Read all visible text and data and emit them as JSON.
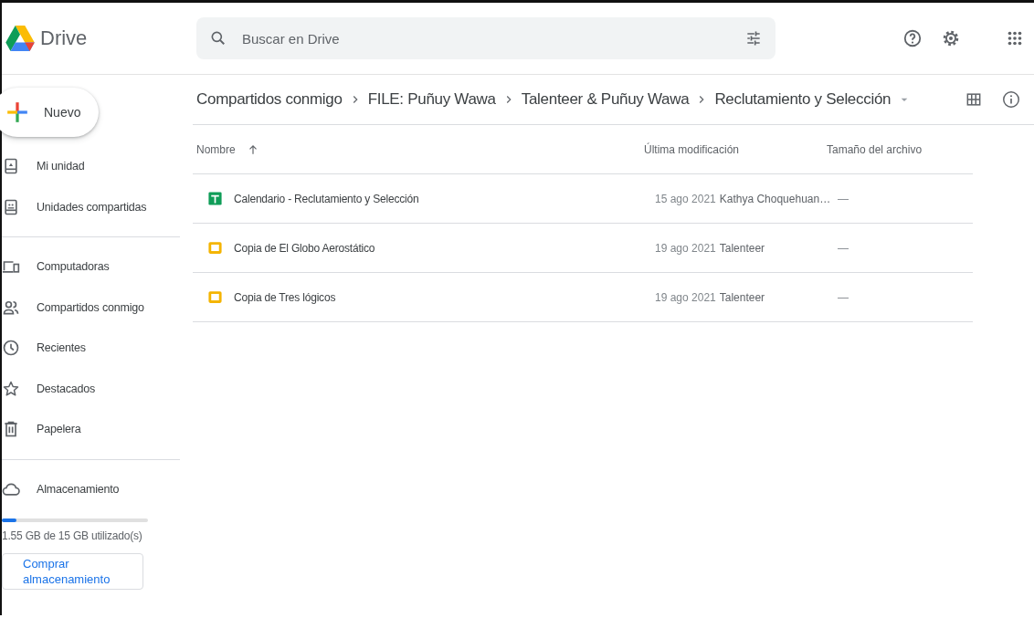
{
  "app": {
    "name": "Drive"
  },
  "search": {
    "placeholder": "Buscar en Drive"
  },
  "new_button": {
    "label": "Nuevo"
  },
  "sidebar": {
    "groups": [
      [
        {
          "label": "Mi unidad"
        },
        {
          "label": "Unidades compartidas"
        }
      ],
      [
        {
          "label": "Computadoras"
        },
        {
          "label": "Compartidos conmigo"
        },
        {
          "label": "Recientes"
        },
        {
          "label": "Destacados"
        },
        {
          "label": "Papelera"
        }
      ],
      [
        {
          "label": "Almacenamiento"
        }
      ]
    ]
  },
  "storage": {
    "level": 0.1,
    "usage": "1.55 GB de 15 GB utilizado(s)",
    "buy_button": "Comprar almacenamiento"
  },
  "breadcrumb": [
    {
      "label": "Compartidos conmigo"
    },
    {
      "label": "FILE: Puñuy Wawa"
    },
    {
      "label": "Talenteer & Puñuy Wawa"
    },
    {
      "label": "Reclutamiento y Selección",
      "dropdown": true
    }
  ],
  "table": {
    "columns": [
      "Nombre",
      "Última modificación",
      "Tamaño del archivo"
    ],
    "rows": [
      {
        "kind": "sheet",
        "name": "Calendario - Reclutamiento y Selección",
        "date": "15 ago 2021",
        "owner": "Kathya Choquehuan…",
        "size": "—"
      },
      {
        "kind": "slides",
        "name": "Copia de El Globo Aerostático",
        "date": "19 ago 2021",
        "owner": "Talenteer",
        "size": "—"
      },
      {
        "kind": "slides",
        "name": "Copia de Tres lógicos",
        "date": "19 ago 2021",
        "owner": "Talenteer",
        "size": "—"
      }
    ]
  }
}
